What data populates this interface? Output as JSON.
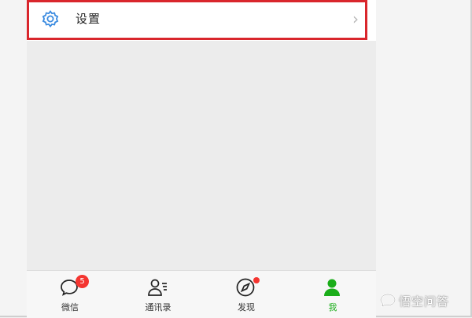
{
  "settings": {
    "label": "设置",
    "chevron": "›",
    "icon": "gear-icon",
    "highlight_color": "#d9262c",
    "icon_color": "#3b8be0"
  },
  "tabbar": {
    "active_color": "#1aad19",
    "badge_color": "#f43530",
    "tabs": [
      {
        "label": "微信",
        "icon": "chat-bubble-icon",
        "badge": "5"
      },
      {
        "label": "通讯录",
        "icon": "contacts-icon"
      },
      {
        "label": "发现",
        "icon": "compass-icon",
        "dot": true
      },
      {
        "label": "我",
        "icon": "person-icon",
        "active": true
      }
    ]
  },
  "watermark": {
    "text": "悟空问答"
  }
}
